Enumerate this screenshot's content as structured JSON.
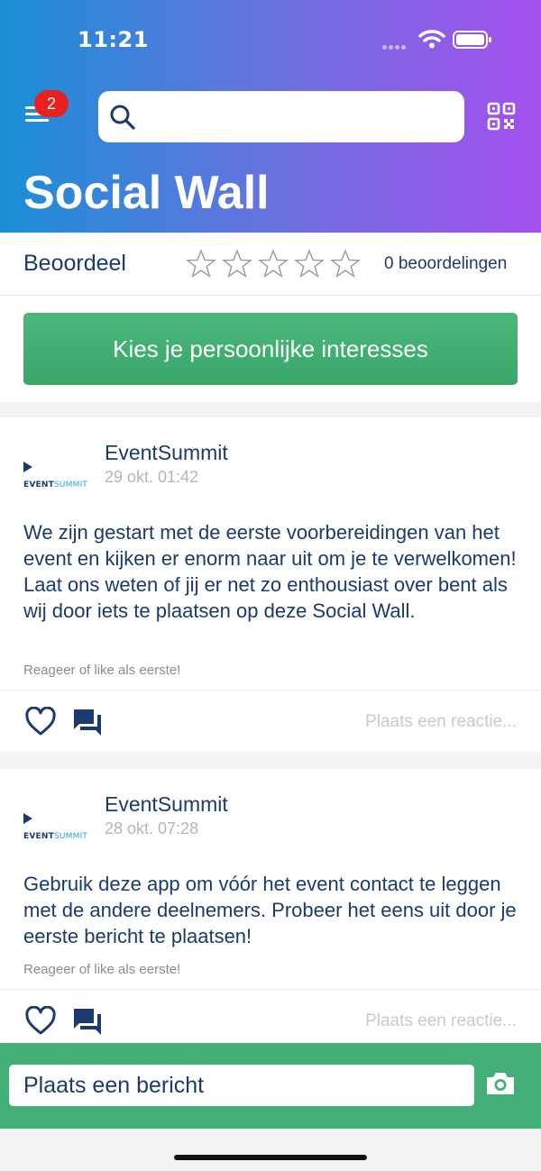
{
  "status_bar": {
    "time": "11:21"
  },
  "header": {
    "menu_badge": "2",
    "search": {
      "placeholder": "",
      "value": ""
    },
    "title": "Social Wall"
  },
  "rating": {
    "label": "Beoordeel",
    "stars_total": 5,
    "stars_filled": 0,
    "count_text": "0 beoordelingen"
  },
  "interests_button": "Kies je persoonlijke interesses",
  "posts": [
    {
      "author": "EventSummit",
      "time": "29 okt. 01:42",
      "logo_text_event": "EVENT",
      "logo_text_summit": "SUMMIT",
      "text": "We zijn gestart met de eerste voorbereidingen van het event en kijken er enorm naar uit om je te verwelkomen! Laat ons weten of jij er net zo enthousiast over bent als wij door iets te plaatsen op deze Social Wall.",
      "hint": "Reageer of like als eerste!",
      "reply_placeholder": "Plaats een reactie..."
    },
    {
      "author": "EventSummit",
      "time": "28 okt. 07:28",
      "logo_text_event": "EVENT",
      "logo_text_summit": "SUMMIT",
      "text": "Gebruik deze app om vóór het event contact te leggen met de andere deelnemers. Probeer het eens uit door je eerste bericht te plaatsen!",
      "hint": "Reageer of like als eerste!",
      "reply_placeholder": "Plaats een reactie..."
    }
  ],
  "composer": {
    "placeholder": "Plaats een bericht"
  },
  "icons": [
    "menu-icon",
    "search-icon",
    "qr-code-icon",
    "star-icon",
    "heart-icon",
    "comment-icon",
    "camera-icon",
    "wifi-icon",
    "battery-icon"
  ],
  "colors": {
    "header_gradient_start": "#1a8fd6",
    "header_gradient_end": "#a450ee",
    "primary_text": "#1b3a70",
    "green": "#42b076",
    "badge_red": "#e8201f"
  }
}
